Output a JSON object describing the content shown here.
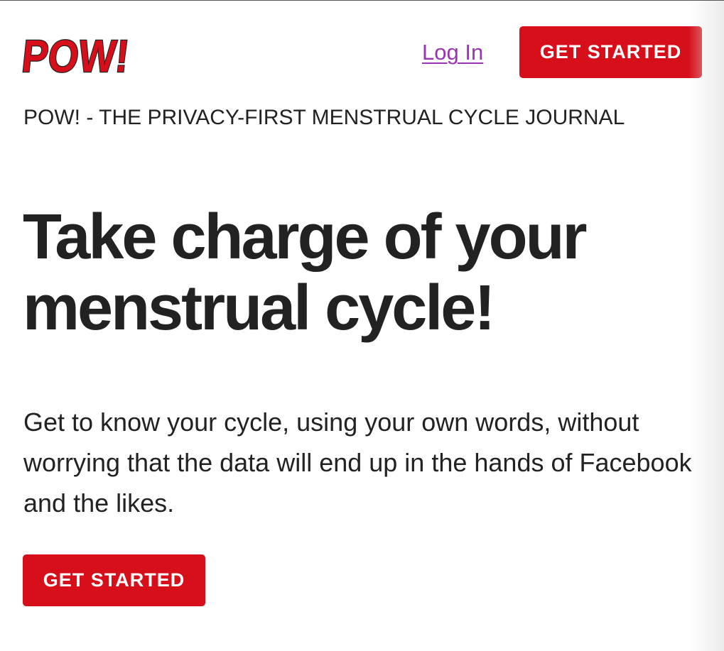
{
  "colors": {
    "brand_red": "#d70f1b",
    "link_purple": "#9b33b5",
    "text_dark": "#222222"
  },
  "header": {
    "logo_text": "POW!",
    "logo_icon": "pow-comic-logo",
    "login_label": "Log In",
    "cta_label": "GET STARTED"
  },
  "main": {
    "tagline": "POW! - THE PRIVACY-FIRST MENSTRUAL CYCLE JOURNAL",
    "title_line1": "Take charge of your",
    "title_line2": "menstrual cycle!",
    "description": "Get to know your cycle, using your own words, without worrying that the data will end up in the hands of Facebook and the likes.",
    "cta_label": "GET STARTED"
  }
}
